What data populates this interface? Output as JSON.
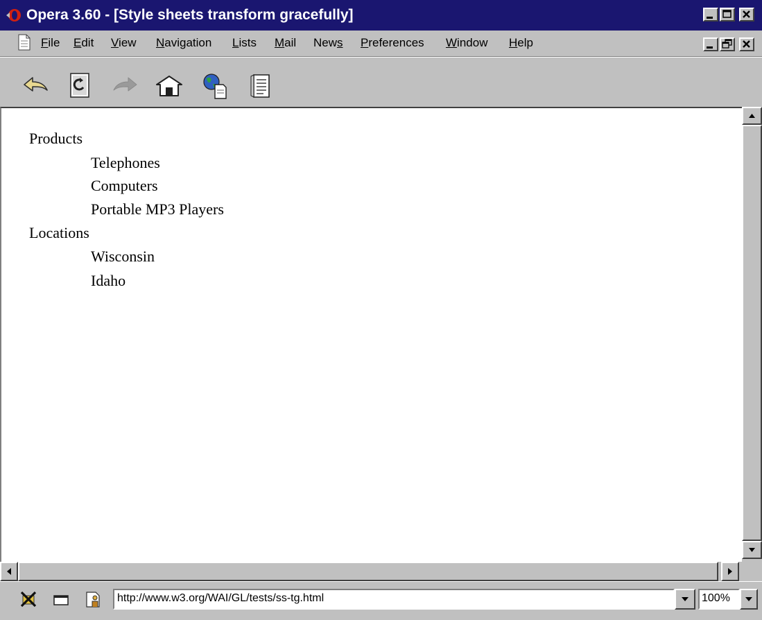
{
  "window": {
    "title": "Opera 3.60 - [Style sheets transform gracefully]",
    "title_bar_color": "#1a1670"
  },
  "menu": {
    "items": [
      {
        "label": "File",
        "accel": "F",
        "rest": "ile"
      },
      {
        "label": "Edit",
        "accel": "E",
        "rest": "dit"
      },
      {
        "label": "View",
        "accel": "V",
        "rest": "iew"
      },
      {
        "label": "Navigation",
        "accel": "N",
        "rest": "avigation"
      },
      {
        "label": "Lists",
        "accel": "L",
        "rest": "ists"
      },
      {
        "label": "Mail",
        "accel": "M",
        "rest": "ail"
      },
      {
        "label": "News",
        "pre": "New",
        "accel": "s"
      },
      {
        "label": "Preferences",
        "accel": "P",
        "rest": "references"
      },
      {
        "label": "Window",
        "accel": "W",
        "rest": "indow"
      },
      {
        "label": "Help",
        "accel": "H",
        "rest": "elp"
      }
    ]
  },
  "toolbar": {
    "icons": [
      "back-arrow-icon",
      "reload-page-icon",
      "forward-arrow-icon",
      "home-icon",
      "hotlist-globe-icon",
      "print-list-icon"
    ]
  },
  "content": {
    "tree": [
      {
        "label": "Products",
        "level": 0
      },
      {
        "label": "Telephones",
        "level": 1
      },
      {
        "label": "Computers",
        "level": 1
      },
      {
        "label": "Portable MP3 Players",
        "level": 1
      },
      {
        "label": "Locations",
        "level": 0
      },
      {
        "label": "Wisconsin",
        "level": 1
      },
      {
        "label": "Idaho",
        "level": 1
      }
    ]
  },
  "status": {
    "url": "http://www.w3.org/WAI/GL/tests/ss-tg.html",
    "zoom": "100%",
    "icons": [
      "images-off-icon",
      "window-icon",
      "user-mode-icon"
    ]
  }
}
